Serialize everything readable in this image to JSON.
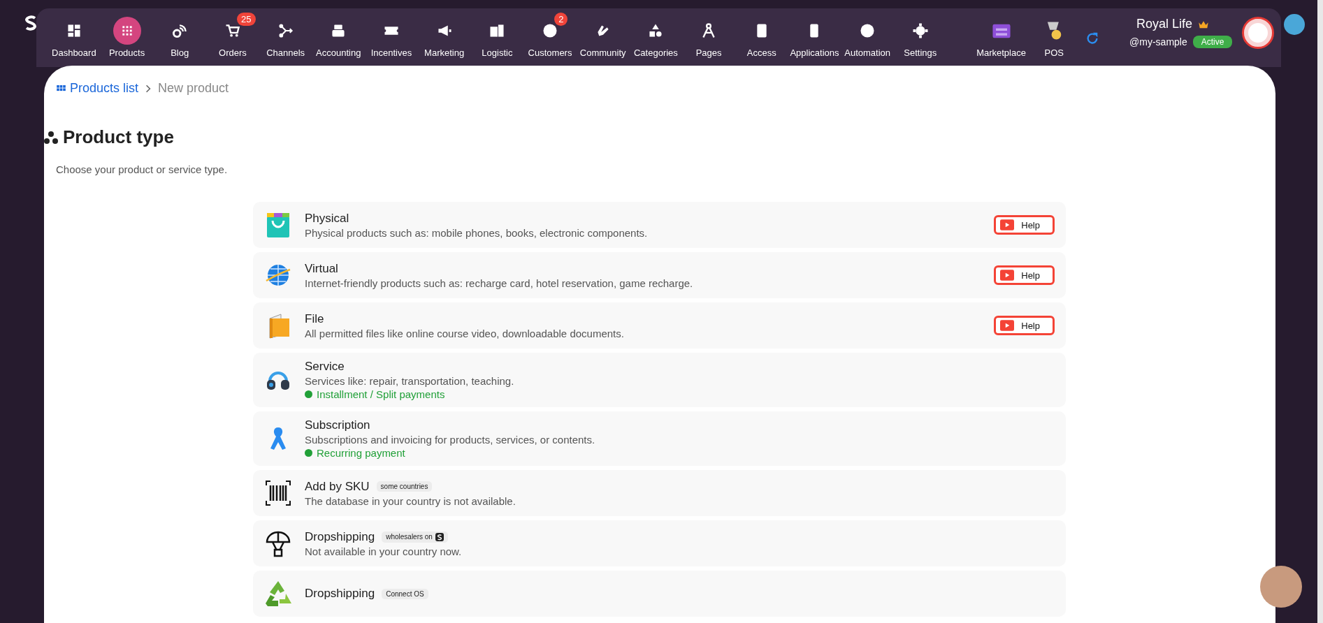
{
  "nav": {
    "items": [
      {
        "label": "Dashboard",
        "selected": false
      },
      {
        "label": "Products",
        "selected": true
      },
      {
        "label": "Blog",
        "selected": false
      },
      {
        "label": "Orders",
        "selected": false,
        "badge": "25"
      },
      {
        "label": "Channels",
        "selected": false
      },
      {
        "label": "Accounting",
        "selected": false
      },
      {
        "label": "Incentives",
        "selected": false
      },
      {
        "label": "Marketing",
        "selected": false
      },
      {
        "label": "Logistic",
        "selected": false
      },
      {
        "label": "Customers",
        "selected": false,
        "badge": "2"
      },
      {
        "label": "Community",
        "selected": false
      },
      {
        "label": "Categories",
        "selected": false
      },
      {
        "label": "Pages",
        "selected": false
      },
      {
        "label": "Access",
        "selected": false
      },
      {
        "label": "Applications",
        "selected": false
      },
      {
        "label": "Automation",
        "selected": false
      },
      {
        "label": "Settings",
        "selected": false
      }
    ],
    "extras": [
      {
        "label": "Marketplace"
      },
      {
        "label": "POS"
      }
    ]
  },
  "account": {
    "name": "Royal Life",
    "handle": "@my-sample",
    "status": "Active"
  },
  "breadcrumb": {
    "parent": "Products list",
    "current": "New product"
  },
  "heading": {
    "title": "Product type",
    "subtitle": "Choose your product or service type."
  },
  "product_types": [
    {
      "title": "Physical",
      "description": "Physical products such as: mobile phones, books, electronic components.",
      "help": "Help"
    },
    {
      "title": "Virtual",
      "description": "Internet-friendly products such as: recharge card, hotel reservation, game recharge.",
      "help": "Help"
    },
    {
      "title": "File",
      "description": "All permitted files like online course video, downloadable documents.",
      "help": "Help"
    },
    {
      "title": "Service",
      "description": "Services like: repair, transportation, teaching.",
      "note": "Installment / Split payments"
    },
    {
      "title": "Subscription",
      "description": "Subscriptions and invoicing for products, services, or contents.",
      "note": "Recurring payment"
    },
    {
      "title": "Add by SKU",
      "tag": "some countries",
      "description": "The database in your country is not available."
    },
    {
      "title": "Dropshipping",
      "tag": "wholesalers on",
      "tag_logo": true,
      "description": "Not available in your country now."
    },
    {
      "title": "Dropshipping",
      "tag": "Connect OS"
    }
  ]
}
